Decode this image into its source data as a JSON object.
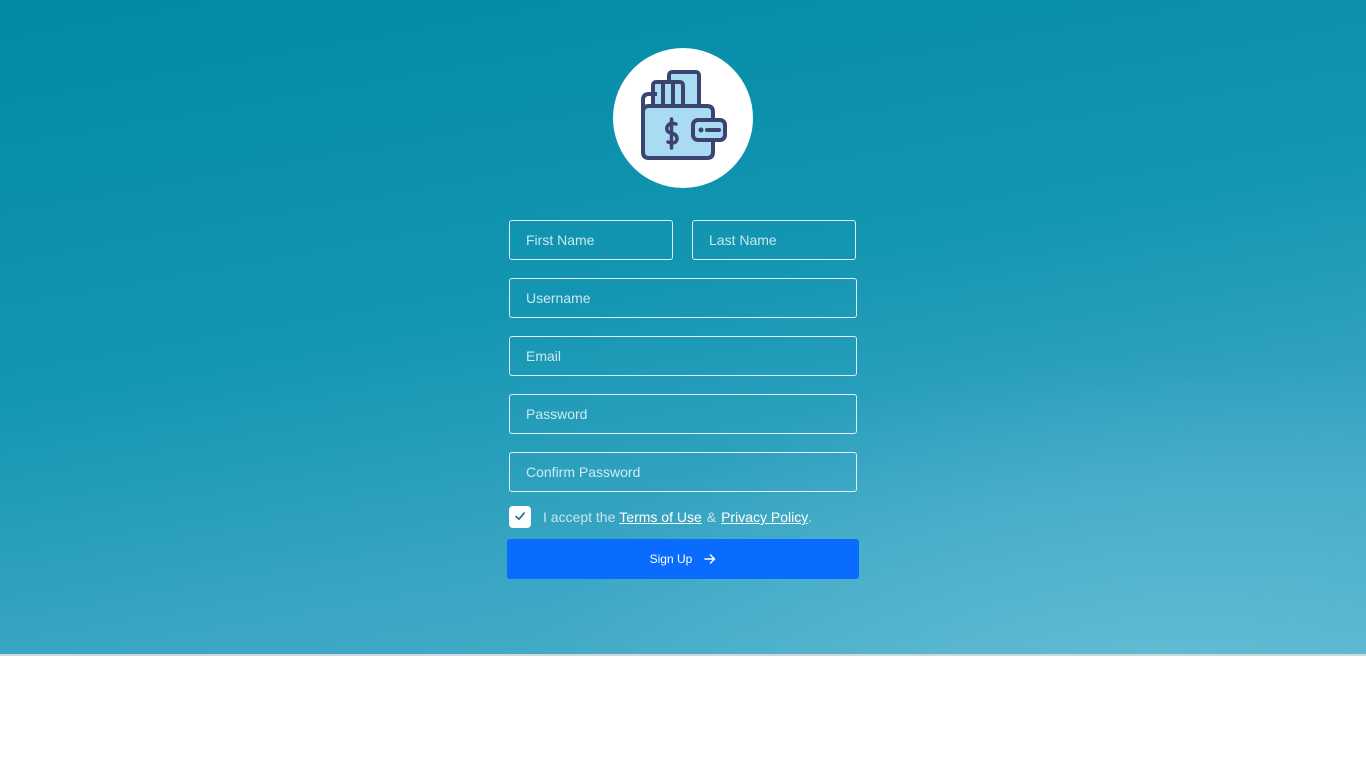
{
  "logo": {
    "icon": "wallet-dollar-icon",
    "colors": {
      "fill": "#a9dcf3",
      "stroke": "#3b4470"
    }
  },
  "form": {
    "first_name_placeholder": "First Name",
    "last_name_placeholder": "Last Name",
    "username_placeholder": "Username",
    "email_placeholder": "Email",
    "password_placeholder": "Password",
    "confirm_password_placeholder": "Confirm Password",
    "terms": {
      "checked": true,
      "prefix": "I accept the",
      "terms_link": "Terms of Use",
      "separator": "&",
      "privacy_link": "Privacy Policy",
      "suffix": "."
    },
    "submit_label": "Sign Up",
    "submit_icon": "arrow-right-icon"
  },
  "colors": {
    "background_start": "#008aa4",
    "background_end": "#4fb1cb",
    "button": "#0a6cff",
    "text": "#ffffff"
  }
}
